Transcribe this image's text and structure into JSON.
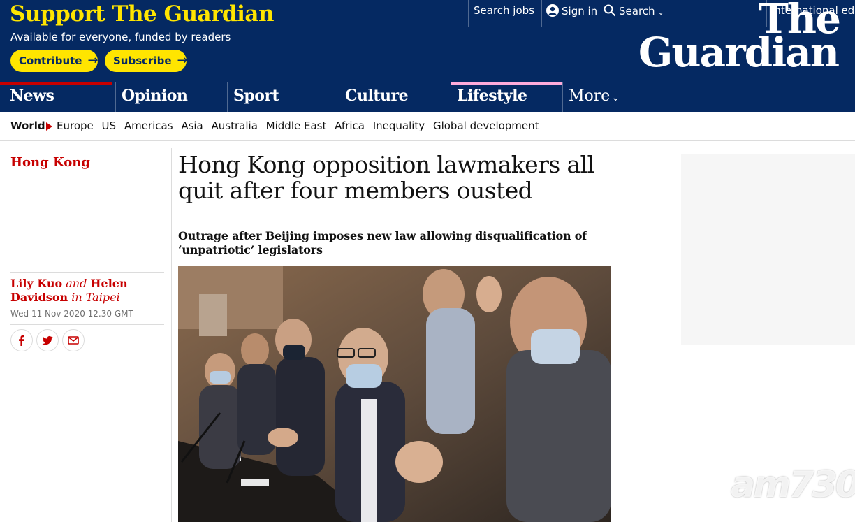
{
  "header": {
    "support_title": "Support The Guardian",
    "support_sub": "Available for everyone, funded by readers",
    "contribute_label": "Contribute",
    "subscribe_label": "Subscribe",
    "search_jobs": "Search jobs",
    "sign_in": "Sign in",
    "search": "Search",
    "edition": "International edi",
    "logo_line1": "The",
    "logo_line2": "Guardian",
    "colors": {
      "brand": "#052962",
      "highlight": "#ffe500"
    }
  },
  "pillars": [
    {
      "label": "News",
      "color": "#c70000"
    },
    {
      "label": "Opinion",
      "color": "#e05e00"
    },
    {
      "label": "Sport",
      "color": "#0084c6"
    },
    {
      "label": "Culture",
      "color": "#a1845c"
    },
    {
      "label": "Lifestyle",
      "color": "#ffabdb"
    }
  ],
  "more_label": "More",
  "subnav": {
    "current": "World",
    "items": [
      "Europe",
      "US",
      "Americas",
      "Asia",
      "Australia",
      "Middle East",
      "Africa",
      "Inequality",
      "Global development"
    ]
  },
  "article": {
    "section": "Hong Kong",
    "headline": "Hong Kong opposition lawmakers all quit after four members ousted",
    "standfirst": "Outrage after Beijing imposes new law allowing disqualification of ‘unpatriotic’ legislators",
    "byline": {
      "author1": "Lily Kuo",
      "and": "and",
      "author2": "Helen Davidson",
      "in": "in",
      "location": "Taipei"
    },
    "date": "Wed 11 Nov 2020 12.30 GMT",
    "share_icons": [
      "facebook-icon",
      "twitter-icon",
      "email-icon"
    ]
  },
  "watermark": "am730"
}
